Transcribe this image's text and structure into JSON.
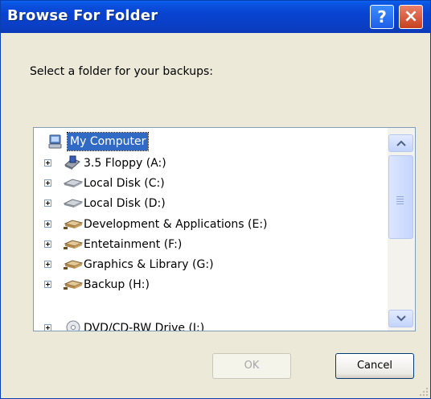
{
  "window": {
    "title": "Browse For Folder",
    "help_label": "?",
    "close_label": "×"
  },
  "prompt": "Select a folder for your backups:",
  "tree": {
    "root": {
      "label": "My Computer",
      "icon": "my-computer-icon",
      "selected": true
    },
    "items": [
      {
        "label": "3.5 Floppy (A:)",
        "icon": "floppy-drive-icon"
      },
      {
        "label": "Local Disk (C:)",
        "icon": "hard-disk-icon"
      },
      {
        "label": "Local Disk (D:)",
        "icon": "hard-disk-icon"
      },
      {
        "label": "Development & Applications (E:)",
        "icon": "network-drive-icon"
      },
      {
        "label": "Entetainment (F:)",
        "icon": "network-drive-icon"
      },
      {
        "label": "Graphics & Library (G:)",
        "icon": "network-drive-icon"
      },
      {
        "label": "Backup (H:)",
        "icon": "network-drive-icon"
      },
      {
        "label": "DVD/CD-RW Drive (I:)",
        "icon": "dvd-drive-icon"
      }
    ]
  },
  "buttons": {
    "ok": "OK",
    "cancel": "Cancel"
  },
  "colors": {
    "titlebar": "#0a49d8",
    "selection": "#316ac5",
    "dialog_bg": "#ece9d8"
  }
}
